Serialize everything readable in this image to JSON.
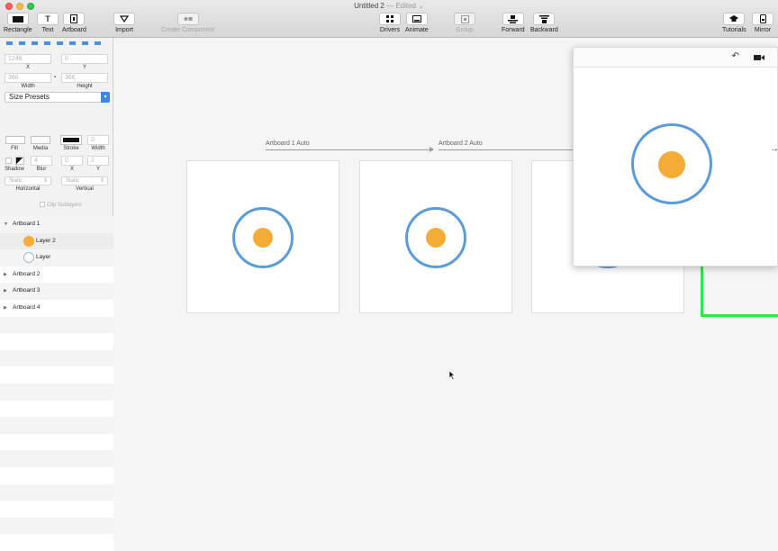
{
  "window": {
    "title": "Untitled 2",
    "edited": "— Edited ⌄"
  },
  "toolbar": {
    "rectangle": "Rectangle",
    "text": "Text",
    "artboard": "Artboard",
    "import": "Import",
    "create_component": "Create Component",
    "drivers": "Drivers",
    "animate": "Animate",
    "group": "Group",
    "forward": "Forward",
    "backward": "Backward",
    "tutorials": "Tutorials",
    "mirror": "Mirror"
  },
  "inspector": {
    "x_value": "1248",
    "y_value": "0",
    "x_label": "X",
    "y_label": "Y",
    "width_value": "366",
    "height_value": "366",
    "width_label": "Width",
    "height_label": "Height",
    "size_presets": "Size Presets",
    "fill_label": "Fill",
    "media_label": "Media",
    "stroke_label": "Stroke",
    "stroke_width_label": "Width",
    "stroke_width_value": "0",
    "shadow_label": "Shadow",
    "blur_label": "Blur",
    "blur_value": "4",
    "shadow_x_label": "X",
    "shadow_x_value": "0",
    "shadow_y_label": "Y",
    "shadow_y_value": "2",
    "horizontal_value": "Static",
    "vertical_value": "Static",
    "horizontal_label": "Horizontal",
    "vertical_label": "Vertical",
    "clip_sublayers": "Clip Sublayers"
  },
  "layers": [
    {
      "name": "Artboard 1",
      "expanded": true
    },
    {
      "name": "Layer 2",
      "child": true
    },
    {
      "name": "Layer",
      "child": true
    },
    {
      "name": "Artboard 2",
      "expanded": false
    },
    {
      "name": "Artboard 3",
      "expanded": false
    },
    {
      "name": "Artboard 4",
      "expanded": false
    }
  ],
  "canvas": {
    "connection_1": "Artboard 1 Auto",
    "connection_2": "Artboard 2 Auto"
  },
  "colors": {
    "accent": "#3d86e8",
    "ring": "#5b9bd8",
    "dot": "#f4ac36",
    "selection": "#2ee84a"
  }
}
